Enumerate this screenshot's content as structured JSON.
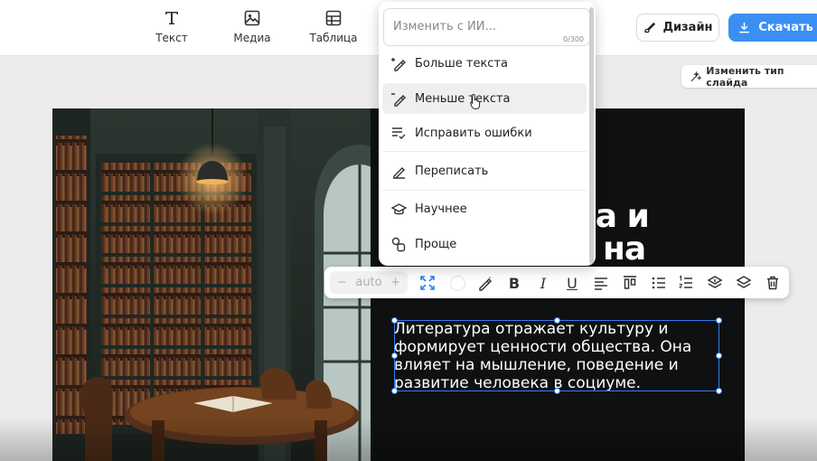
{
  "toolbar": {
    "tools": [
      {
        "label": "Текст",
        "icon": "text-icon"
      },
      {
        "label": "Медиа",
        "icon": "image-icon"
      },
      {
        "label": "Таблица",
        "icon": "table-icon"
      }
    ],
    "design_label": "Дизайн",
    "download_label": "Скачать"
  },
  "change_slide_type_label": "Изменить тип слайда",
  "ai_menu": {
    "placeholder": "Изменить с ИИ...",
    "counter": "0/300",
    "items": [
      {
        "label": "Больше текста",
        "icon": "pen-plus-icon"
      },
      {
        "label": "Меньше текста",
        "icon": "pen-minus-icon"
      },
      {
        "label": "Исправить ошибки",
        "icon": "list-check-icon"
      },
      {
        "label": "Переписать",
        "icon": "pencil-icon"
      },
      {
        "label": "Научнее",
        "icon": "graduation-cap-icon"
      },
      {
        "label": "Проще",
        "icon": "shapes-icon"
      }
    ]
  },
  "format_bar": {
    "size_value": "auto",
    "minus": "−",
    "plus": "+",
    "bold": "B",
    "italic": "I",
    "underline": "U"
  },
  "slide": {
    "title_line1": "ра и",
    "title_line2": "е на",
    "body": "Литература отражает культуру и формирует ценности общества. Она влияет на мышление, поведение и развитие человека в социуме."
  },
  "colors": {
    "accent": "#3b8ff3",
    "slide_bg": "#0f1012",
    "selection": "#2f7ff2"
  }
}
